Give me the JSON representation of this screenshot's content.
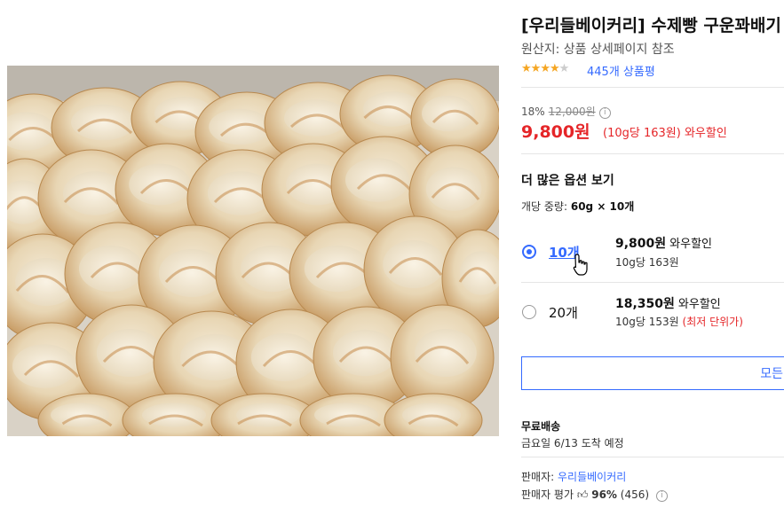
{
  "product": {
    "title": "[우리들베이커리] 수제빵 구운꽈배기",
    "origin": "원산지: 상품 상세페이지 참조",
    "rating_stars": 4,
    "review_count": "445개 상품평"
  },
  "price": {
    "discount_rate": "18%",
    "original_price": "12,000원",
    "sale_price": "9,800원",
    "unit_price": "(10g당 163원)",
    "wow_label": "와우할인"
  },
  "options": {
    "header": "더 많은 옵션 보기",
    "weight_label": "개당 중량:",
    "weight_value": "60g × 10개",
    "items": [
      {
        "label": "10개",
        "price": "9,800원",
        "tag": "와우할인",
        "unit": "10g당 163원",
        "note": "",
        "selected": true
      },
      {
        "label": "20개",
        "price": "18,350원",
        "tag": "와우할인",
        "unit": "10g당 153원",
        "note": "(최저 단위가)",
        "selected": false
      }
    ],
    "more_button": "모든"
  },
  "shipping": {
    "title": "무료배송",
    "date": "금요일 6/13 도착 예정"
  },
  "seller": {
    "label": "판매자:",
    "name": "우리들베이커리",
    "rating_label": "판매자 평가",
    "rating_percent": "96%",
    "rating_count": "(456)"
  },
  "colors": {
    "accent_blue": "#346aff",
    "price_red": "#e52528",
    "star": "#f5a623"
  }
}
